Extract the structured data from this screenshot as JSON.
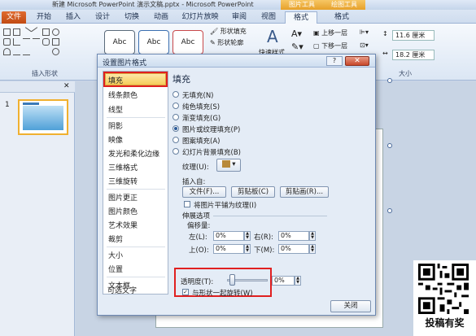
{
  "window": {
    "title": "新建 Microsoft PowerPoint 演示文稿.pptx - Microsoft PowerPoint",
    "context_tab_headers": [
      "绘图工具",
      "图片工具"
    ]
  },
  "tabs": [
    "文件",
    "开始",
    "插入",
    "设计",
    "切换",
    "动画",
    "幻灯片放映",
    "审阅",
    "视图",
    "格式",
    "格式"
  ],
  "ribbon": {
    "group_insert_shapes": "插入形状",
    "shape_styles": [
      "Abc",
      "Abc",
      "Abc"
    ],
    "shape_fill": "形状填充",
    "shape_outline": "形状轮廓",
    "quick_styles": "快速样式",
    "bring_forward": "上移一层",
    "send_backward": "下移一层",
    "height_value": "11.6 厘米",
    "width_value": "18.2 厘米",
    "group_size": "大小"
  },
  "slide_pane": {
    "slide_number": "1"
  },
  "dialog": {
    "title": "设置图片格式",
    "help": "?",
    "close": "✕",
    "nav": [
      "填充",
      "线条颜色",
      "线型",
      "阴影",
      "映像",
      "发光和柔化边缘",
      "三维格式",
      "三维旋转",
      "图片更正",
      "图片颜色",
      "艺术效果",
      "裁剪",
      "大小",
      "位置",
      "文本框",
      "可选文字"
    ],
    "panel_heading": "填充",
    "fill_options": [
      "无填充(N)",
      "纯色填充(S)",
      "渐变填充(G)",
      "图片或纹理填充(P)",
      "图案填充(A)",
      "幻灯片背景填充(B)"
    ],
    "selected_fill": 3,
    "texture_label": "纹理(U):",
    "insert_from": "插入自:",
    "btn_file": "文件(F)...",
    "btn_clipboard": "剪贴板(C)",
    "btn_clipart": "剪贴画(R)...",
    "tile_checkbox": "将图片平铺为纹理(I)",
    "stretch_options": "伸展选项",
    "offset_label": "偏移量:",
    "left_label": "左(L):",
    "left_value": "0%",
    "right_label": "右(R):",
    "right_value": "0%",
    "top_label": "上(O):",
    "top_value": "0%",
    "bottom_label": "下(M):",
    "bottom_value": "0%",
    "transparency_label": "透明度(T):",
    "transparency_value": "0%",
    "rotate_checkbox": "与形状一起旋转(W)",
    "close_button": "关闭"
  },
  "watermark": {
    "caption": "投稿有奖"
  },
  "colors": {
    "highlight_red": "#e02020",
    "selected_nav": "#f6cc5a",
    "file_tab": "#c14a12"
  }
}
